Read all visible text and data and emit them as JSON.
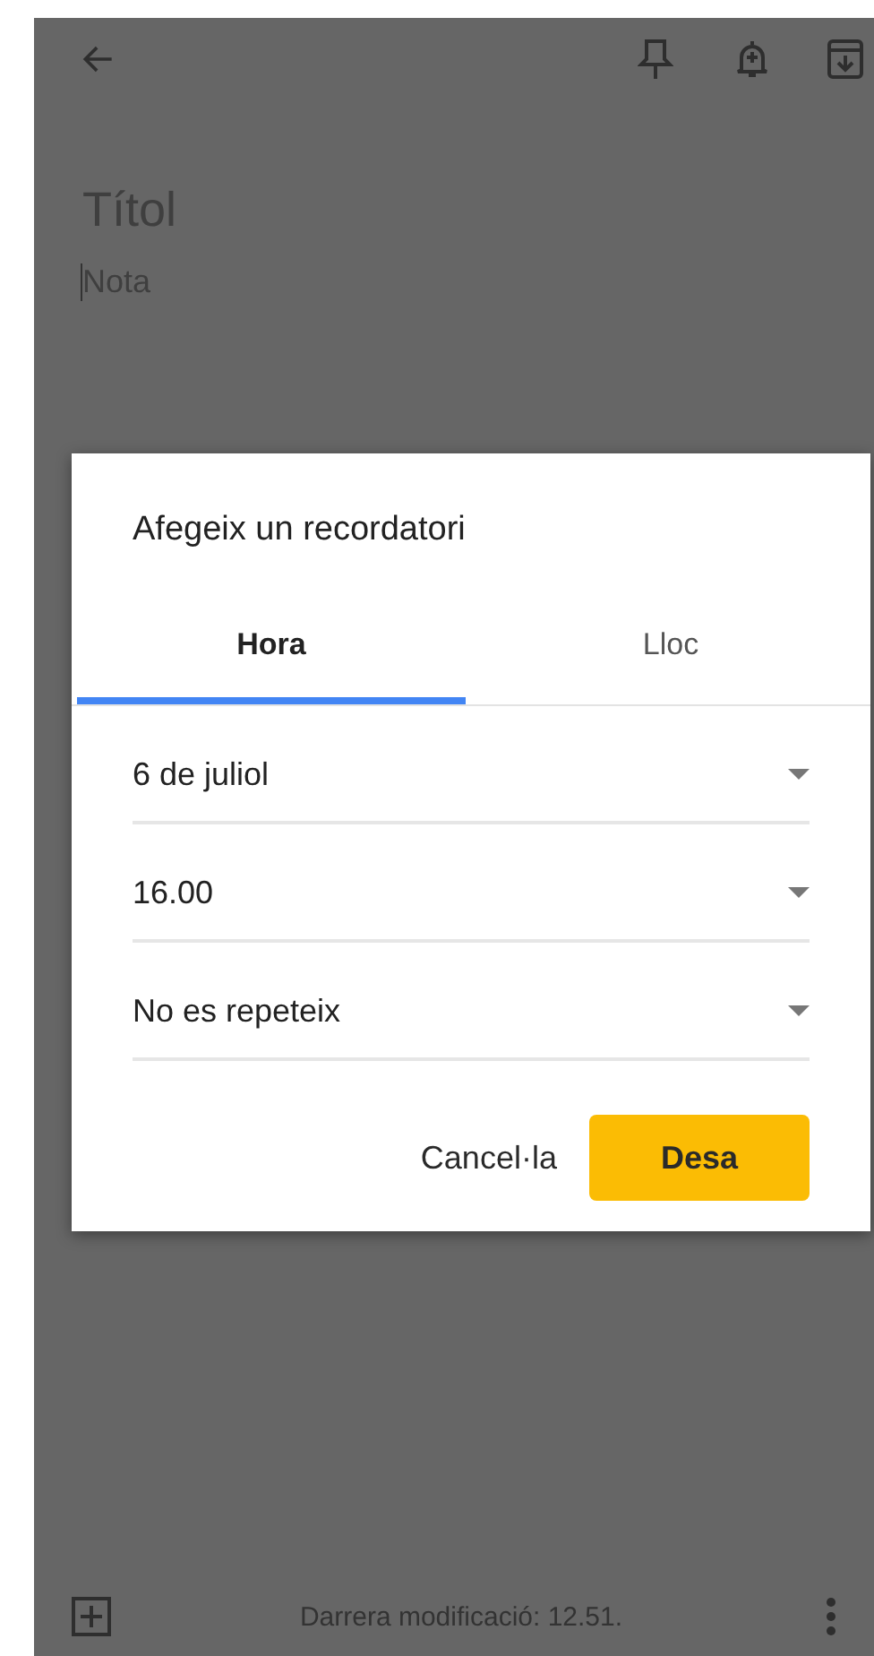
{
  "note": {
    "title_placeholder": "Títol",
    "body_placeholder": "Nota"
  },
  "dialog": {
    "title": "Afegeix un recordatori",
    "tabs": [
      {
        "label": "Hora",
        "selected": true
      },
      {
        "label": "Lloc",
        "selected": false
      }
    ],
    "fields": [
      {
        "value": "6 de juliol"
      },
      {
        "value": "16.00"
      },
      {
        "value": "No es repeteix"
      }
    ],
    "buttons": [
      {
        "label": "Cancel·la",
        "kind": "text"
      },
      {
        "label": "Desa",
        "kind": "filled"
      }
    ]
  },
  "status_bar": {
    "text": "Darrera modificació: 12.51."
  }
}
